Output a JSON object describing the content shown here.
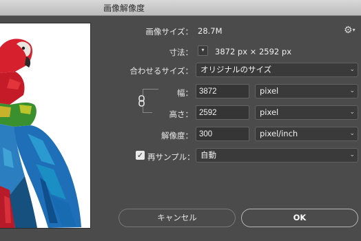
{
  "window": {
    "title": "画像解像度"
  },
  "image_size": {
    "label": "画像サイズ：",
    "value": "28.7M"
  },
  "dimensions": {
    "label": "寸法：",
    "value": "3872 px × 2592 px"
  },
  "fit_to": {
    "label": "合わせるサイズ：",
    "value": "オリジナルのサイズ"
  },
  "width": {
    "label": "幅：",
    "value": "3872",
    "unit": "pixel"
  },
  "height": {
    "label": "高さ：",
    "value": "2592",
    "unit": "pixel"
  },
  "resolution": {
    "label": "解像度：",
    "value": "300",
    "unit": "pixel/inch"
  },
  "resample": {
    "label": "再サンプル：",
    "checked": true,
    "value": "自動"
  },
  "buttons": {
    "cancel": "キャンセル",
    "ok": "OK"
  },
  "icons": {
    "gear": "gear-icon",
    "link": "chain-link-icon",
    "dropdown": "chevron-down-icon"
  }
}
